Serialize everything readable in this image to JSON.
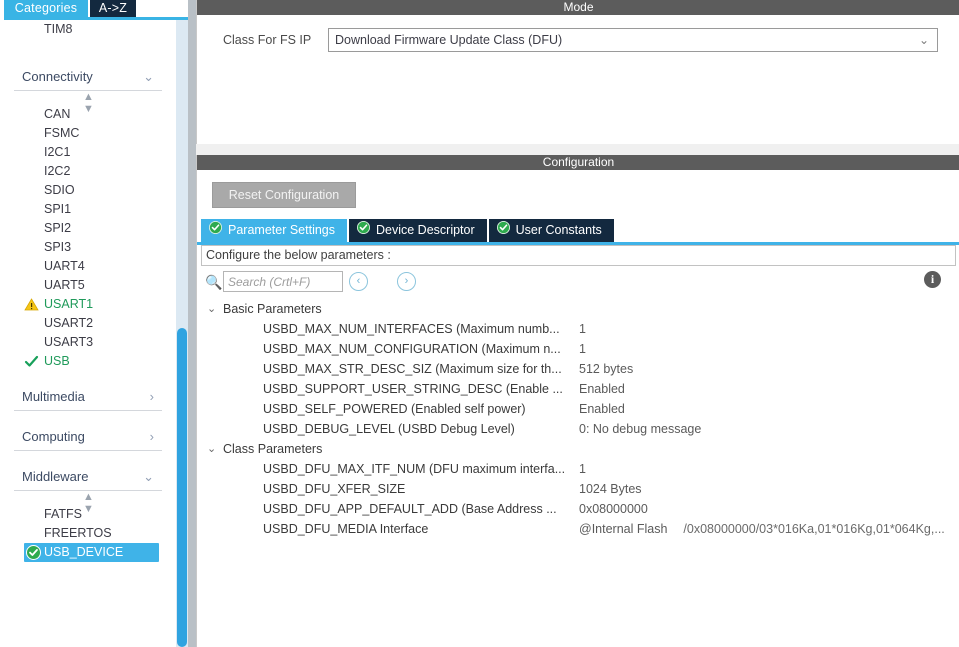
{
  "left_panel": {
    "tabs": [
      {
        "label": "Categories",
        "active": true
      },
      {
        "label": "A->Z",
        "active": false
      }
    ],
    "top_leaf": {
      "label": "TIM8"
    },
    "sections": [
      {
        "name": "Connectivity",
        "chevron": "chevron-down",
        "items": [
          {
            "label": "CAN",
            "state": "none"
          },
          {
            "label": "FSMC",
            "state": "none"
          },
          {
            "label": "I2C1",
            "state": "none"
          },
          {
            "label": "I2C2",
            "state": "none"
          },
          {
            "label": "SDIO",
            "state": "none"
          },
          {
            "label": "SPI1",
            "state": "none"
          },
          {
            "label": "SPI2",
            "state": "none"
          },
          {
            "label": "SPI3",
            "state": "none"
          },
          {
            "label": "UART4",
            "state": "none"
          },
          {
            "label": "UART5",
            "state": "none"
          },
          {
            "label": "USART1",
            "state": "warning"
          },
          {
            "label": "USART2",
            "state": "none"
          },
          {
            "label": "USART3",
            "state": "none"
          },
          {
            "label": "USB",
            "state": "ok"
          }
        ]
      },
      {
        "name": "Multimedia",
        "chevron": "chevron-right",
        "items": []
      },
      {
        "name": "Computing",
        "chevron": "chevron-right",
        "items": []
      },
      {
        "name": "Middleware",
        "chevron": "chevron-down",
        "items": [
          {
            "label": "FATFS",
            "state": "none"
          },
          {
            "label": "FREERTOS",
            "state": "none"
          },
          {
            "label": "USB_DEVICE",
            "state": "ok-selected",
            "selected": true
          }
        ]
      }
    ]
  },
  "mode_panel": {
    "title": "Mode",
    "class_label": "Class For FS IP",
    "class_value": "Download Firmware Update Class (DFU)"
  },
  "config_panel": {
    "title": "Configuration",
    "reset_label": "Reset Configuration",
    "tabs": [
      {
        "label": "Parameter Settings",
        "active": true
      },
      {
        "label": "Device Descriptor",
        "active": false
      },
      {
        "label": "User Constants",
        "active": false
      }
    ],
    "configure_hint": "Configure the below parameters :",
    "search": {
      "value": "",
      "placeholder": "Search (Crtl+F)"
    },
    "nav_back": "‹",
    "nav_forward": "›",
    "groups": [
      {
        "name": "Basic Parameters",
        "expanded": true,
        "rows": [
          {
            "name": "USBD_MAX_NUM_INTERFACES (Maximum numb...",
            "value": "1"
          },
          {
            "name": "USBD_MAX_NUM_CONFIGURATION (Maximum n...",
            "value": "1"
          },
          {
            "name": "USBD_MAX_STR_DESC_SIZ (Maximum size for th...",
            "value": "512 bytes"
          },
          {
            "name": "USBD_SUPPORT_USER_STRING_DESC (Enable ...",
            "value": "Enabled"
          },
          {
            "name": "USBD_SELF_POWERED (Enabled self power)",
            "value": "Enabled"
          },
          {
            "name": "USBD_DEBUG_LEVEL (USBD Debug Level)",
            "value": "0: No debug message"
          }
        ]
      },
      {
        "name": "Class Parameters",
        "expanded": true,
        "rows": [
          {
            "name": "USBD_DFU_MAX_ITF_NUM (DFU maximum interfa...",
            "value": "1"
          },
          {
            "name": "USBD_DFU_XFER_SIZE",
            "value": "1024 Bytes"
          },
          {
            "name": "USBD_DFU_APP_DEFAULT_ADD (Base Address ...",
            "value": "0x08000000"
          },
          {
            "name": "USBD_DFU_MEDIA Interface",
            "value": "@Internal Flash",
            "value_sub": "/0x08000000/03*016Ka,01*016Kg,01*064Kg,..."
          }
        ]
      }
    ]
  },
  "colors": {
    "accent_blue": "#3fb3e8",
    "tab_dark": "#13293f",
    "panel_header": "#5c5c5c",
    "ok_green": "#1f9a5a",
    "warning_yellow": "#f5c518"
  }
}
